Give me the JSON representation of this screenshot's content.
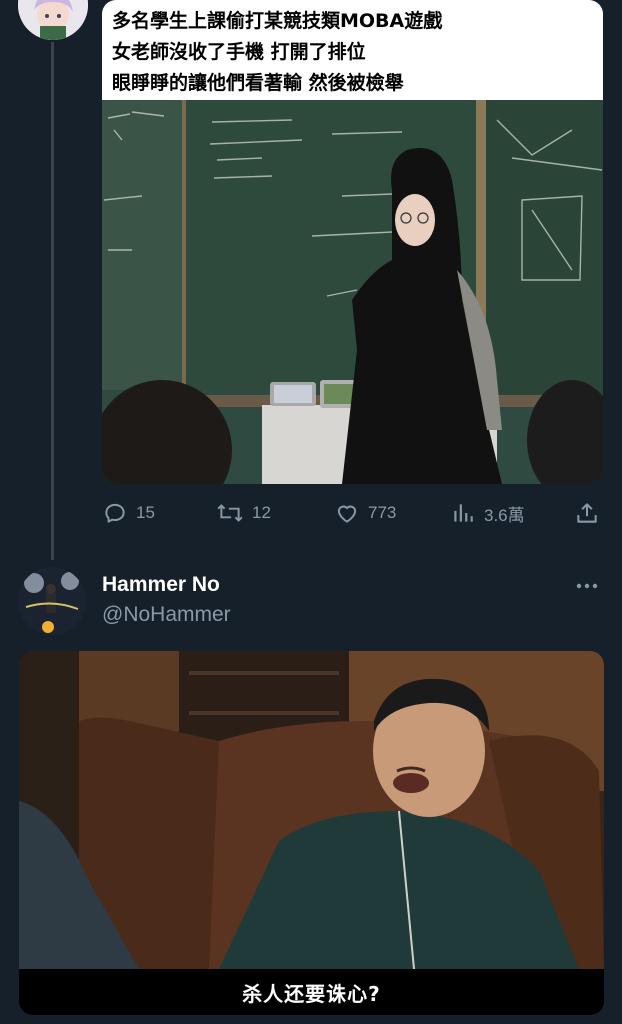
{
  "first_post": {
    "image_caption_lines": [
      "多名學生上課偷打某競技類MOBA遊戲",
      "女老師沒收了手機 打開了排位",
      "眼睜睜的讓他們看著輸 然後被檢舉"
    ],
    "actions": {
      "replies": "15",
      "reposts": "12",
      "likes": "773",
      "views": "3.6萬"
    }
  },
  "reply": {
    "author_name": "Hammer No",
    "author_handle": "@NoHammer",
    "image_subtitle": "杀人还要诛心?"
  },
  "colors": {
    "background": "#15202b",
    "thread_line": "#38444d",
    "secondary_text": "#8b98a5",
    "primary_text": "#ffffff"
  },
  "icons": {
    "reply": "speech-bubble-icon",
    "repost": "repost-arrows-icon",
    "like": "heart-icon",
    "views": "bar-chart-icon",
    "share": "share-upload-icon",
    "more": "more-dots-icon"
  }
}
